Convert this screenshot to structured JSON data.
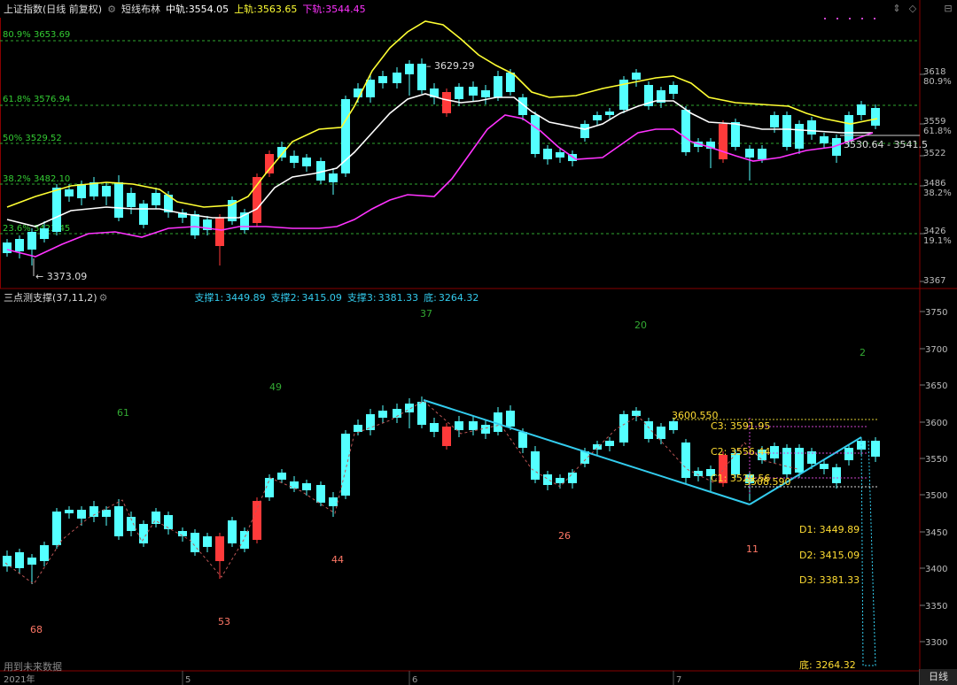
{
  "header": {
    "title": "上证指数(日线 前复权)",
    "indicator_name": "短线布林",
    "mid_label": "中轨:",
    "mid_value": "3554.05",
    "upper_label": "上轨:",
    "upper_value": "3563.65",
    "lower_label": "下轨:",
    "lower_value": "3544.45"
  },
  "sub_header": {
    "title": "三点测支撑(37,11,2)",
    "support1_label": "支撑1:",
    "support1": "3449.89",
    "support2_label": "支撑2:",
    "support2": "3415.09",
    "support3_label": "支撑3:",
    "support3": "3381.33",
    "bottom_label": "底:",
    "bottom": "3264.32"
  },
  "footer": {
    "note": "用到未来数据",
    "period_button": "日线",
    "date_labels": [
      "2021年",
      "5",
      "6",
      "7"
    ]
  },
  "top_panel": {
    "fib_labels": [
      "80.9% 3653.69",
      "61.8% 3576.94",
      "50% 3529.52",
      "38.2% 3482.10",
      "23.6% 3423.45"
    ],
    "annotations": [
      "3629.29",
      "3373.09",
      "3530.64 - 3541.5"
    ],
    "axis_ticks": [
      "3618",
      "80.9%",
      "3559",
      "61.8%",
      "3522",
      "3486",
      "38.2%",
      "3426",
      "19.1%",
      "3367"
    ]
  },
  "bottom_panel": {
    "axis_ticks": [
      "3750",
      "3700",
      "3650",
      "3600",
      "3550",
      "3500",
      "3450",
      "3400",
      "3350",
      "3300"
    ],
    "pivot_numbers": [
      "37",
      "20",
      "49",
      "61",
      "2",
      "26",
      "44",
      "11",
      "68",
      "53"
    ],
    "level_labels": [
      "3600.550",
      "C3: 3591.95",
      "C2: 3556.44",
      "C1: 3529.56",
      "3508.590"
    ],
    "support_labels": [
      "D1: 3449.89",
      "D2: 3415.09",
      "D3: 3381.33",
      "底: 3264.32"
    ]
  },
  "colors": {
    "up": "#ff3a3a",
    "down": "#54ffff",
    "mid_line": "#ffffff",
    "upper_line": "#ffff33",
    "lower_line": "#ff33ff",
    "fib_line": "#33cc33",
    "trend_line": "#33ccee",
    "level_text": "#ffdd33"
  }
}
